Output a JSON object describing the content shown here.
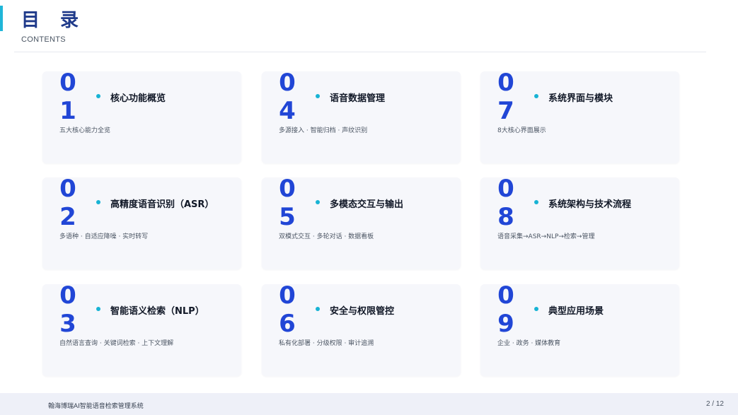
{
  "header": {
    "title": "目 录",
    "subtitle": "CONTENTS"
  },
  "items": [
    {
      "number": "01",
      "title": "核心功能概览",
      "desc": "五大核心能力全览"
    },
    {
      "number": "04",
      "title": "语音数据管理",
      "desc": "多源接入 · 智能归档 · 声纹识别"
    },
    {
      "number": "07",
      "title": "系统界面与模块",
      "desc": "8大核心界面展示"
    },
    {
      "number": "02",
      "title": "高精度语音识别（ASR）",
      "desc": "多语种 · 自适应降噪 · 实时转写"
    },
    {
      "number": "05",
      "title": "多模态交互与输出",
      "desc": "双模式交互 · 多轮对话 · 数据看板"
    },
    {
      "number": "08",
      "title": "系统架构与技术流程",
      "desc": "语音采集→ASR→NLP→检索→管理"
    },
    {
      "number": "03",
      "title": "智能语义检索（NLP）",
      "desc": "自然语言查询 · 关键词检索 · 上下文理解"
    },
    {
      "number": "06",
      "title": "安全与权限管控",
      "desc": "私有化部署 · 分级权限 · 审计追溯"
    },
    {
      "number": "09",
      "title": "典型应用场景",
      "desc": "企业 · 政务 · 媒体教育"
    }
  ],
  "footer": {
    "system_name": "翰海博瑞AI智能语音检索管理系统",
    "page_indicator": "2 / 12"
  },
  "colors": {
    "accent": "#1fb6d8",
    "number": "#2146d6",
    "title": "#1f3a8a"
  }
}
